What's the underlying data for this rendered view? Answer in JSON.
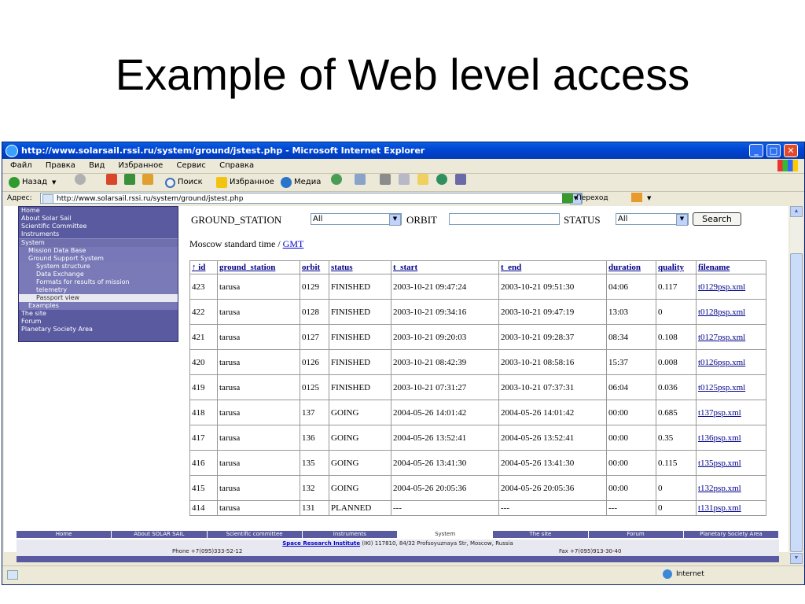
{
  "slide": {
    "title": "Example of Web level access"
  },
  "window": {
    "title": "http://www.solarsail.rssi.ru/system/ground/jstest.php - Microsoft Internet Explorer",
    "min": "_",
    "max": "□",
    "close": "✕"
  },
  "menu": [
    "Файл",
    "Правка",
    "Вид",
    "Избранное",
    "Сервис",
    "Справка"
  ],
  "toolbar": {
    "back": "Назад",
    "search": "Поиск",
    "favorites": "Избранное",
    "media": "Медиа"
  },
  "address": {
    "label": "Адрес:",
    "url": "http://www.solarsail.rssi.ru/system/ground/jstest.php",
    "go": "Переход"
  },
  "nav": {
    "items": [
      {
        "label": "Home",
        "type": "top"
      },
      {
        "label": "About Solar Sail",
        "type": "top"
      },
      {
        "label": "Scientific Committee",
        "type": "top"
      },
      {
        "label": "Instruments",
        "type": "top"
      },
      {
        "label": "System",
        "type": "sec"
      },
      {
        "label": "Mission Data Base",
        "type": "sub"
      },
      {
        "label": "Ground Support System",
        "type": "sub"
      },
      {
        "label": "System structure",
        "type": "sub2"
      },
      {
        "label": "Data Exchange",
        "type": "sub2"
      },
      {
        "label": "Formats for results of mission",
        "type": "sub2"
      },
      {
        "label": "telemetry",
        "type": "sub2"
      },
      {
        "label": "Passport view",
        "type": "sel"
      },
      {
        "label": "Examples",
        "type": "sub"
      },
      {
        "label": "The site",
        "type": "top"
      },
      {
        "label": "Forum",
        "type": "top"
      },
      {
        "label": "Planetary Society Area",
        "type": "top"
      }
    ]
  },
  "filters": {
    "ground_station_label": "GROUND_STATION",
    "ground_station_value": "All",
    "orbit_label": "ORBIT",
    "orbit_value": "",
    "status_label": "STATUS",
    "status_value": "All",
    "search_button": "Search"
  },
  "timezone": {
    "prefix": "Moscow standard time /",
    "gmt": "GMT"
  },
  "table": {
    "columns": [
      "↑ id",
      "ground_station",
      "orbit",
      "status",
      "t_start",
      "t_end",
      "duration",
      "quality",
      "filename"
    ],
    "rows": [
      [
        "423",
        "tarusa",
        "0129",
        "FINISHED",
        "2003-10-21 09:47:24",
        "2003-10-21 09:51:30",
        "04:06",
        "0.117",
        "t0129psp.xml"
      ],
      [
        "422",
        "tarusa",
        "0128",
        "FINISHED",
        "2003-10-21 09:34:16",
        "2003-10-21 09:47:19",
        "13:03",
        "0",
        "t0128psp.xml"
      ],
      [
        "421",
        "tarusa",
        "0127",
        "FINISHED",
        "2003-10-21 09:20:03",
        "2003-10-21 09:28:37",
        "08:34",
        "0.108",
        "t0127psp.xml"
      ],
      [
        "420",
        "tarusa",
        "0126",
        "FINISHED",
        "2003-10-21 08:42:39",
        "2003-10-21 08:58:16",
        "15:37",
        "0.008",
        "t0126psp.xml"
      ],
      [
        "419",
        "tarusa",
        "0125",
        "FINISHED",
        "2003-10-21 07:31:27",
        "2003-10-21 07:37:31",
        "06:04",
        "0.036",
        "t0125psp.xml"
      ],
      [
        "418",
        "tarusa",
        "137",
        "GOING",
        "2004-05-26 14:01:42",
        "2004-05-26 14:01:42",
        "00:00",
        "0.685",
        "t137psp.xml"
      ],
      [
        "417",
        "tarusa",
        "136",
        "GOING",
        "2004-05-26 13:52:41",
        "2004-05-26 13:52:41",
        "00:00",
        "0.35",
        "t136psp.xml"
      ],
      [
        "416",
        "tarusa",
        "135",
        "GOING",
        "2004-05-26 13:41:30",
        "2004-05-26 13:41:30",
        "00:00",
        "0.115",
        "t135psp.xml"
      ],
      [
        "415",
        "tarusa",
        "132",
        "GOING",
        "2004-05-26 20:05:36",
        "2004-05-26 20:05:36",
        "00:00",
        "0",
        "t132psp.xml"
      ],
      [
        "414",
        "tarusa",
        "131",
        "PLANNED",
        "---",
        "---",
        "---",
        "0",
        "t131psp.xml"
      ]
    ]
  },
  "footer": {
    "nav": [
      "Home",
      "About SOLAR SAIL",
      "Scientific committee",
      "Instruments",
      "System",
      "The site",
      "Forum",
      "Planetary Society Area"
    ],
    "current": "System",
    "institute": "Space Research Institute",
    "address": "(IKI) 117810, 84/32 Profsoyuznaya Str, Moscow, Russia",
    "phone": "Phone +7(095)333-52-12",
    "fax": "Fax +7(095)913-30-40"
  },
  "status": {
    "zone": "Internet"
  }
}
